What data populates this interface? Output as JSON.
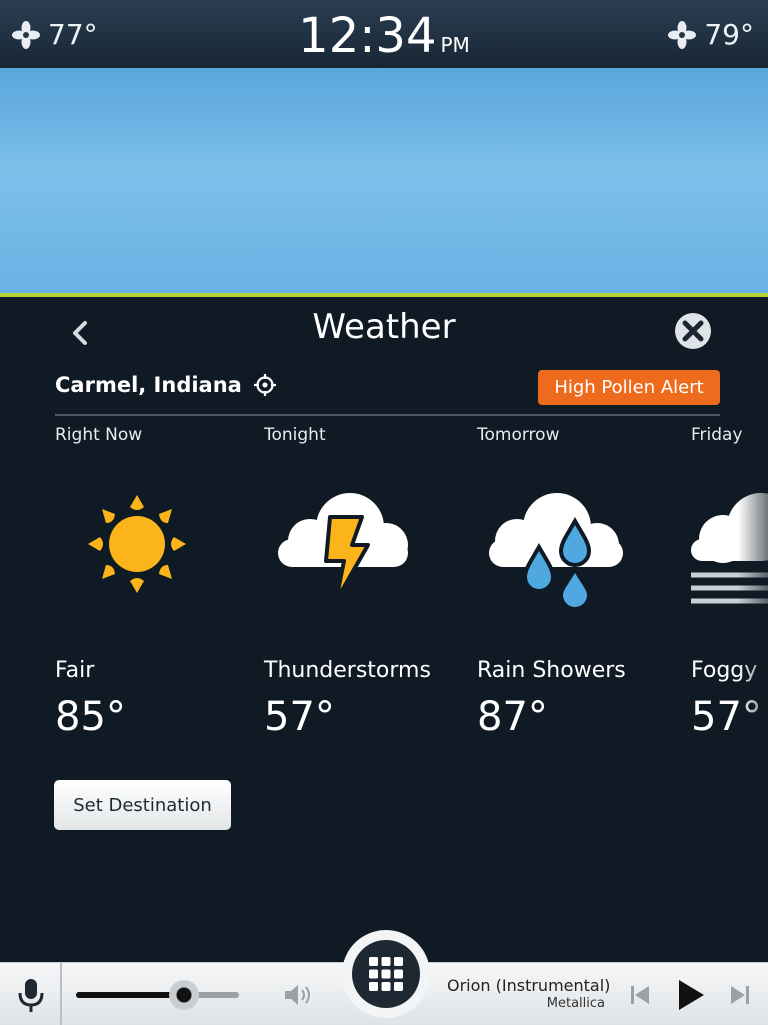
{
  "status_bar": {
    "left_temp": "77°",
    "right_temp": "79°",
    "clock": "12:34",
    "ampm": "PM"
  },
  "panel": {
    "title": "Weather",
    "location": "Carmel, Indiana",
    "alert_label": "High Pollen Alert",
    "set_destination_label": "Set Destination",
    "forecasts": [
      {
        "period": "Right Now",
        "condition": "Fair",
        "temp": "85°",
        "icon": "sun-icon"
      },
      {
        "period": "Tonight",
        "condition": "Thunderstorms",
        "temp": "57°",
        "icon": "thunderstorm-icon"
      },
      {
        "period": "Tomorrow",
        "condition": "Rain Showers",
        "temp": "87°",
        "icon": "rain-icon"
      },
      {
        "period": "Friday",
        "condition": "Foggy",
        "temp": "57°",
        "icon": "fog-icon"
      }
    ]
  },
  "media": {
    "track_title": "Orion (Instrumental)",
    "artist": "Metallica",
    "volume_fraction": 0.66
  },
  "colors": {
    "accent_orange": "#ee6b1e",
    "sun_yellow": "#fbb41a",
    "rain_blue": "#4fa8e0",
    "sky_line": "#b9d33a"
  }
}
